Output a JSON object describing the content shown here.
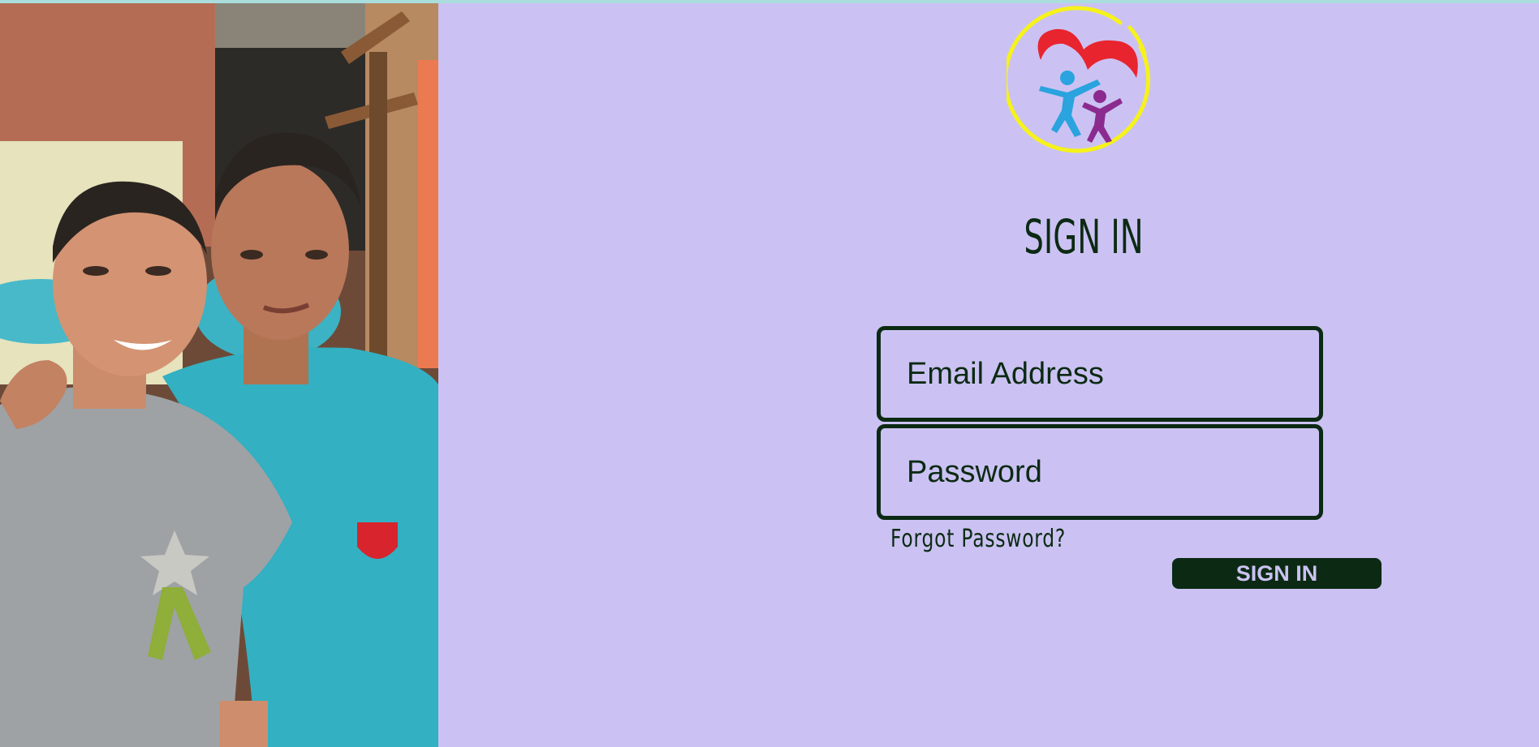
{
  "page": {
    "background_color": "#cbc2f3",
    "accent_color": "#0c2a13",
    "top_strip_color": "#a9dedd"
  },
  "hero_image": {
    "subject": "two-women-smiling-photo"
  },
  "logo": {
    "icon": "heart-family-logo-icon",
    "colors": {
      "ring": "#f6f21a",
      "heart": "#e8242f",
      "adult": "#2aa3de",
      "child": "#8b2b8f"
    }
  },
  "signin": {
    "title": "SIGN IN",
    "email_placeholder": "Email Address",
    "password_placeholder": "Password",
    "forgot_label": "Forgot Password?",
    "submit_label": "SIGN IN"
  }
}
